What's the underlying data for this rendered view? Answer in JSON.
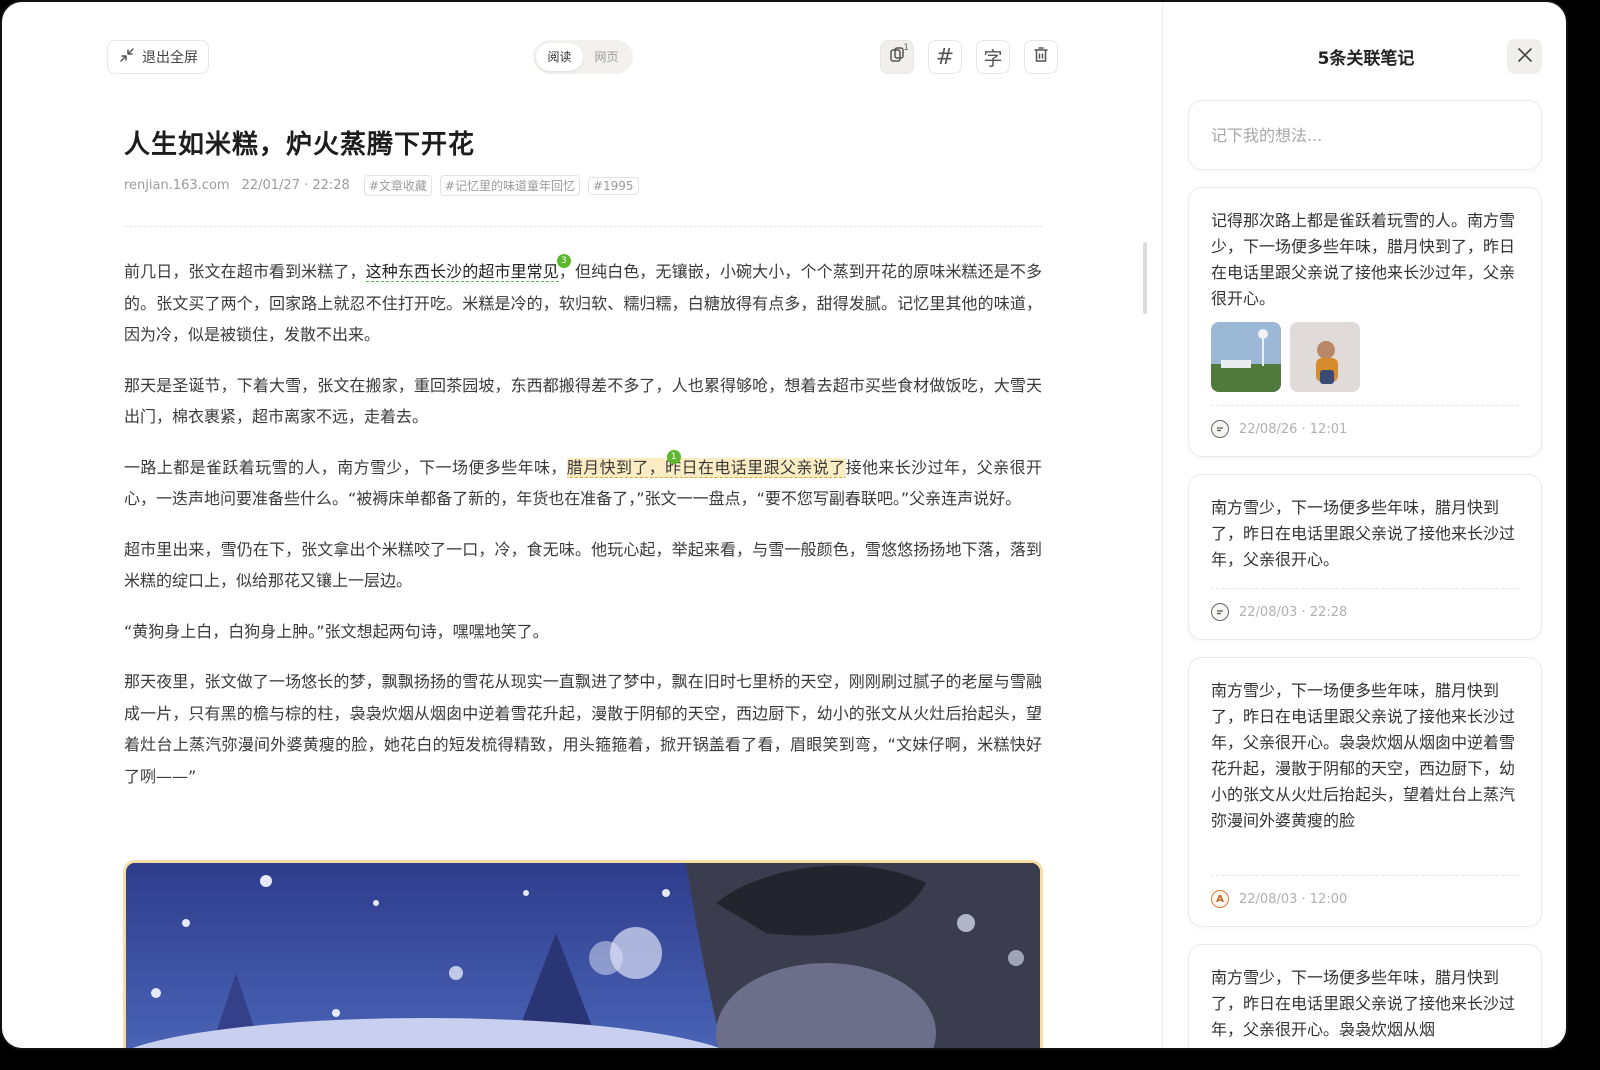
{
  "toolbar": {
    "exit_fullscreen_label": "退出全屏",
    "mode_tabs": [
      "阅读",
      "网页"
    ],
    "active_mode": "阅读",
    "notes_badge": "1",
    "tag_tool_glyph": "#",
    "font_tool_glyph": "字"
  },
  "article": {
    "title": "人生如米糕，炉火蒸腾下开花",
    "source": "renjian.163.com",
    "datetime": "22/01/27 · 22:28",
    "tags": [
      "#文章收藏",
      "#记忆里的味道童年回忆",
      "#1995"
    ],
    "p1_a": "前几日，张文在超市看到米糕了，",
    "p1_hl": "这种东西长沙的超市里常见",
    "p1_hl_count": "3",
    "p1_b": "，但纯白色，无镶嵌，小碗大小，个个蒸到开花的原味米糕还是不多的。张文买了两个，回家路上就忍不住打开吃。米糕是冷的，软归软、糯归糯，白糖放得有点多，甜得发腻。记忆里其他的味道，因为冷，似是被锁住，发散不出来。",
    "p2": "那天是圣诞节，下着大雪，张文在搬家，重回茶园坡，东西都搬得差不多了，人也累得够呛，想着去超市买些食材做饭吃，大雪天出门，棉衣裹紧，超市离家不远，走着去。",
    "p3_a": "一路上都是雀跃着玩雪的人，南方雪少，下一场便多些年味，",
    "p3_hl": "腊月快到了，昨日在电话里跟父亲说了",
    "p3_hl_count": "1",
    "p3_b": "接他来长沙过年，父亲很开心，一迭声地问要准备些什么。“被褥床单都备了新的，年货也在准备了，”张文一一盘点，“要不您写副春联吧。”父亲连声说好。",
    "p4": "超市里出来，雪仍在下，张文拿出个米糕咬了一口，冷，食无味。他玩心起，举起来看，与雪一般颜色，雪悠悠扬扬地下落，落到米糕的绽口上，似给那花又镶上一层边。",
    "p5": "“黄狗身上白，白狗身上肿。”张文想起两句诗，嘿嘿地笑了。",
    "p6": "那天夜里，张文做了一场悠长的梦，飘飘扬扬的雪花从现实一直飘进了梦中，飘在旧时七里桥的天空，刚刚刷过腻子的老屋与雪融成一片，只有黑的檐与棕的柱，袅袅炊烟从烟囱中逆着雪花升起，漫散于阴郁的天空，西边厨下，幼小的张文从火灶后抬起头，望着灶台上蒸汽弥漫间外婆黄瘦的脸，她花白的短发梳得精致，用头箍箍着，掀开锅盖看了看，眉眼笑到弯，“文妹仔啊，米糕快好了咧——”"
  },
  "panel": {
    "title": "5条关联笔记",
    "input_placeholder": "记下我的想法...",
    "notes": [
      {
        "text": "记得那次路上都是雀跃着玩雪的人。南方雪少，下一场便多些年味，腊月快到了，昨日在电话里跟父亲说了接他来长沙过年，父亲很开心。",
        "time": "22/08/26 · 12:01",
        "icon": "comment-icon"
      },
      {
        "text": "南方雪少，下一场便多些年味，腊月快到了，昨日在电话里跟父亲说了接他来长沙过年，父亲很开心。",
        "time": "22/08/03 · 22:28",
        "icon": "comment-icon"
      },
      {
        "text": "南方雪少，下一场便多些年味，腊月快到了，昨日在电话里跟父亲说了接他来长沙过年，父亲很开心。袅袅炊烟从烟囱中逆着雪花升起，漫散于阴郁的天空，西边厨下，幼小的张文从火灶后抬起头，望着灶台上蒸汽弥漫间外婆黄瘦的脸",
        "time": "22/08/03 · 12:00",
        "icon": "highlight-icon"
      },
      {
        "text": "南方雪少，下一场便多些年味，腊月快到了，昨日在电话里跟父亲说了接他来长沙过年，父亲很开心。袅袅炊烟从烟"
      }
    ]
  }
}
